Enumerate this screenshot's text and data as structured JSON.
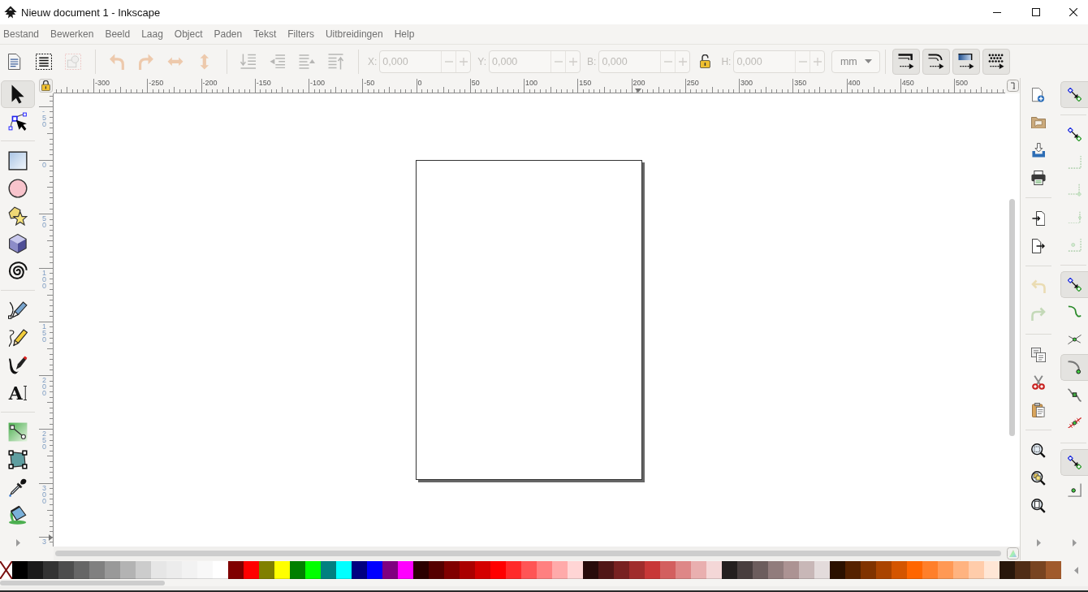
{
  "window": {
    "title": "Nieuw document 1 - Inkscape"
  },
  "menu": [
    {
      "label": "Bestand"
    },
    {
      "label": "Bewerken"
    },
    {
      "label": "Beeld"
    },
    {
      "label": "Laag"
    },
    {
      "label": "Object"
    },
    {
      "label": "Paden"
    },
    {
      "label": "Tekst"
    },
    {
      "label": "Filters"
    },
    {
      "label": "Uitbreidingen"
    },
    {
      "label": "Help"
    }
  ],
  "selection_toolbar": {
    "groups": [
      {
        "buttons": [
          {
            "kind": "selectall",
            "disabled": false
          },
          {
            "kind": "selectalllayers",
            "disabled": false
          },
          {
            "kind": "deselect",
            "disabled": true
          }
        ]
      },
      {
        "buttons": [
          {
            "kind": "rotateccw",
            "disabled": true
          },
          {
            "kind": "rotatecw",
            "disabled": true
          },
          {
            "kind": "fliph",
            "disabled": true
          },
          {
            "kind": "flipv",
            "disabled": true
          }
        ]
      },
      {
        "buttons": [
          {
            "kind": "raisetop",
            "disabled": true
          },
          {
            "kind": "raise",
            "disabled": true
          },
          {
            "kind": "lower",
            "disabled": true
          },
          {
            "kind": "lowerbottom",
            "disabled": true
          }
        ]
      }
    ],
    "controls": [
      {
        "kind": "spin",
        "label": "X:",
        "value": "0,000",
        "disabled": true
      },
      {
        "kind": "spin",
        "label": "Y:",
        "value": "0,000",
        "disabled": true
      },
      {
        "kind": "spin",
        "label": "B:",
        "value": "0,000",
        "disabled": true
      },
      {
        "kind": "lock",
        "locked": false
      },
      {
        "kind": "spin",
        "label": "H:",
        "value": "0,000",
        "disabled": true
      },
      {
        "kind": "unit",
        "value": "mm"
      }
    ],
    "toggles": [
      {
        "kind": "stroke",
        "on": true
      },
      {
        "kind": "corners",
        "on": true
      },
      {
        "kind": "gradient",
        "on": true
      },
      {
        "kind": "pattern",
        "on": true
      }
    ]
  },
  "toolbox": {
    "groups": [
      {
        "tools": [
          {
            "kind": "selector",
            "selected": true
          },
          {
            "kind": "node",
            "selected": false
          }
        ]
      },
      {
        "tools": [
          {
            "kind": "rect",
            "selected": false
          },
          {
            "kind": "ellipse",
            "selected": false
          },
          {
            "kind": "star",
            "selected": false
          },
          {
            "kind": "box3d",
            "selected": false
          },
          {
            "kind": "spiral",
            "selected": false
          }
        ]
      },
      {
        "tools": [
          {
            "kind": "pen",
            "selected": false
          },
          {
            "kind": "pencil",
            "selected": false
          },
          {
            "kind": "calligraphy",
            "selected": false
          },
          {
            "kind": "text",
            "glyph": "A",
            "selected": false
          }
        ]
      },
      {
        "tools": [
          {
            "kind": "gradient",
            "selected": false
          },
          {
            "kind": "mesh",
            "selected": false
          },
          {
            "kind": "dropper",
            "selected": false
          },
          {
            "kind": "bucket",
            "selected": false
          }
        ]
      }
    ]
  },
  "rulers": {
    "guides_locked": true,
    "horizontal": [
      "-300",
      "-250",
      "-200",
      "-150",
      "-100",
      "-50",
      "0",
      "50",
      "100",
      "150",
      "200",
      "250",
      "300",
      "350",
      "400",
      "450",
      "500"
    ],
    "vertical": [
      "-50",
      "0",
      "50",
      "100",
      "150",
      "200",
      "250",
      "300",
      "3"
    ]
  },
  "commands_bar": {
    "groups": [
      {
        "buttons": [
          {
            "kind": "new",
            "disabled": false
          },
          {
            "kind": "open",
            "disabled": false
          },
          {
            "kind": "save",
            "disabled": false
          },
          {
            "kind": "print",
            "disabled": false
          }
        ]
      },
      {
        "buttons": [
          {
            "kind": "import",
            "disabled": false
          },
          {
            "kind": "export",
            "disabled": false
          }
        ]
      },
      {
        "buttons": [
          {
            "kind": "undo",
            "disabled": true
          },
          {
            "kind": "redo",
            "disabled": true
          }
        ]
      },
      {
        "buttons": [
          {
            "kind": "copy",
            "disabled": false
          },
          {
            "kind": "cut",
            "disabled": false
          },
          {
            "kind": "paste",
            "disabled": false
          }
        ]
      },
      {
        "buttons": [
          {
            "kind": "zoomselection",
            "disabled": false
          },
          {
            "kind": "zoomdrawing",
            "disabled": false
          },
          {
            "kind": "zoompage",
            "disabled": false
          }
        ]
      }
    ]
  },
  "snap_bar": {
    "groups": [
      {
        "buttons": [
          {
            "kind": "snap",
            "on": true,
            "disabled": false
          }
        ]
      },
      {
        "buttons": [
          {
            "kind": "bbox",
            "on": false,
            "disabled": false
          },
          {
            "kind": "bboxedges",
            "on": false,
            "disabled": true
          },
          {
            "kind": "bboxcorners",
            "on": false,
            "disabled": true
          },
          {
            "kind": "bboxmidpoints",
            "on": false,
            "disabled": true
          },
          {
            "kind": "bboxcenters",
            "on": false,
            "disabled": true
          }
        ]
      },
      {
        "buttons": [
          {
            "kind": "nodes",
            "on": true,
            "disabled": false
          },
          {
            "kind": "paths",
            "on": false,
            "disabled": false
          },
          {
            "kind": "intersections",
            "on": false,
            "disabled": false
          },
          {
            "kind": "cusps",
            "on": true,
            "disabled": false
          },
          {
            "kind": "smooth",
            "on": false,
            "disabled": false
          },
          {
            "kind": "midpoints",
            "on": false,
            "disabled": false
          }
        ]
      },
      {
        "buttons": [
          {
            "kind": "others",
            "on": true,
            "disabled": false
          },
          {
            "kind": "centers",
            "on": false,
            "disabled": false
          }
        ]
      }
    ]
  },
  "palette": {
    "swatches": [
      {
        "color": "#000000"
      },
      {
        "color": "#1a1a1a"
      },
      {
        "color": "#333333"
      },
      {
        "color": "#4d4d4d"
      },
      {
        "color": "#666666"
      },
      {
        "color": "#808080"
      },
      {
        "color": "#999999"
      },
      {
        "color": "#b3b3b3"
      },
      {
        "color": "#cccccc"
      },
      {
        "color": "#e6e6e6"
      },
      {
        "color": "#ececec"
      },
      {
        "color": "#f2f2f2"
      },
      {
        "color": "#f8f8f8"
      },
      {
        "color": "#ffffff"
      },
      {
        "color": "#800000"
      },
      {
        "color": "#ff0000"
      },
      {
        "color": "#808000"
      },
      {
        "color": "#ffff00"
      },
      {
        "color": "#008000"
      },
      {
        "color": "#00ff00"
      },
      {
        "color": "#008080"
      },
      {
        "color": "#00ffff"
      },
      {
        "color": "#000080"
      },
      {
        "color": "#0000ff"
      },
      {
        "color": "#800080"
      },
      {
        "color": "#ff00ff"
      },
      {
        "color": "#2b0000"
      },
      {
        "color": "#550000"
      },
      {
        "color": "#800000"
      },
      {
        "color": "#aa0000"
      },
      {
        "color": "#d40000"
      },
      {
        "color": "#ff0000"
      },
      {
        "color": "#ff2a2a"
      },
      {
        "color": "#ff5555"
      },
      {
        "color": "#ff8080"
      },
      {
        "color": "#ffaaaa"
      },
      {
        "color": "#ffd5d5"
      },
      {
        "color": "#280b0b"
      },
      {
        "color": "#501616"
      },
      {
        "color": "#782121"
      },
      {
        "color": "#a02c2c"
      },
      {
        "color": "#c83737"
      },
      {
        "color": "#d35f5f"
      },
      {
        "color": "#de8787"
      },
      {
        "color": "#e9afaf"
      },
      {
        "color": "#f4d7d7"
      },
      {
        "color": "#241f1f"
      },
      {
        "color": "#483e3e"
      },
      {
        "color": "#6c5d5d"
      },
      {
        "color": "#917c7c"
      },
      {
        "color": "#ac9393"
      },
      {
        "color": "#c8b7b7"
      },
      {
        "color": "#e3dbdb"
      },
      {
        "color": "#2b1100"
      },
      {
        "color": "#552200"
      },
      {
        "color": "#803300"
      },
      {
        "color": "#aa4400"
      },
      {
        "color": "#d45500"
      },
      {
        "color": "#ff6600"
      },
      {
        "color": "#ff7f2a"
      },
      {
        "color": "#ff9955"
      },
      {
        "color": "#ffb380"
      },
      {
        "color": "#ffccaa"
      },
      {
        "color": "#ffe6d5"
      },
      {
        "color": "#28170b"
      },
      {
        "color": "#502d16"
      },
      {
        "color": "#784421"
      },
      {
        "color": "#a05a2c"
      }
    ]
  }
}
